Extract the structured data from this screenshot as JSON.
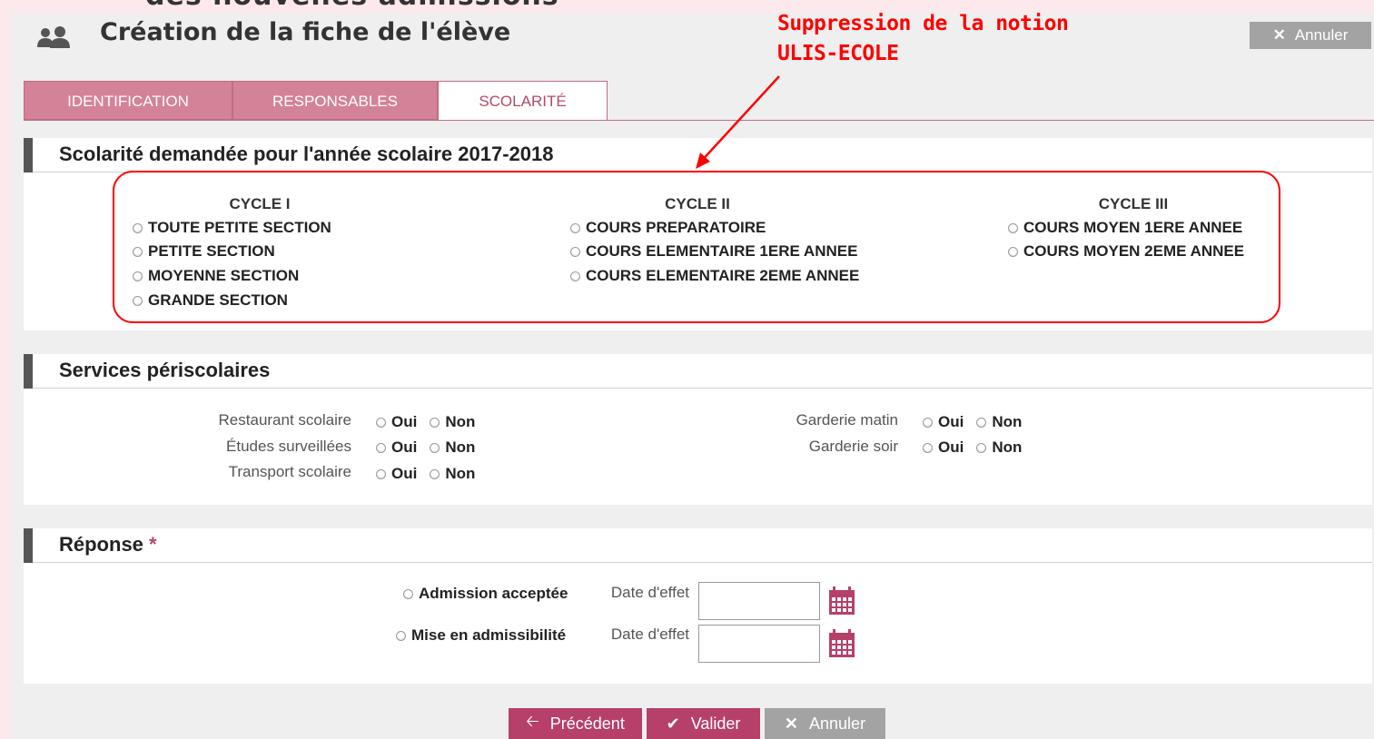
{
  "banner": {
    "partial_title": "des nouvelles admissions"
  },
  "header": {
    "title": "Création de la fiche de l'élève",
    "cancel_label": "Annuler"
  },
  "annotation": {
    "line1": "Suppression de la notion",
    "line2": "ULIS-ECOLE"
  },
  "tabs": [
    {
      "label": "IDENTIFICATION",
      "active": false
    },
    {
      "label": "RESPONSABLES",
      "active": false
    },
    {
      "label": "SCOLARITÉ",
      "active": true
    }
  ],
  "scolarite": {
    "title": "Scolarité demandée pour l'année scolaire 2017-2018",
    "cycles": [
      {
        "heading": "CYCLE I",
        "options": [
          "TOUTE PETITE SECTION",
          "PETITE SECTION",
          "MOYENNE SECTION",
          "GRANDE SECTION"
        ]
      },
      {
        "heading": "CYCLE II",
        "options": [
          "COURS PREPARATOIRE",
          "COURS ELEMENTAIRE 1ERE ANNEE",
          "COURS ELEMENTAIRE 2EME ANNEE"
        ]
      },
      {
        "heading": "CYCLE III",
        "options": [
          "COURS MOYEN 1ERE ANNEE",
          "COURS MOYEN 2EME ANNEE"
        ]
      }
    ]
  },
  "periscolaire": {
    "title": "Services périscolaires",
    "yes_label": "Oui",
    "no_label": "Non",
    "left": [
      "Restaurant scolaire",
      "Études surveillées",
      "Transport scolaire"
    ],
    "right": [
      "Garderie matin",
      "Garderie soir"
    ]
  },
  "reponse": {
    "title": "Réponse",
    "required_mark": "*",
    "options": [
      "Admission acceptée",
      "Mise en admissibilité"
    ],
    "date_label": "Date d'effet"
  },
  "footer": {
    "prev_label": "Précédent",
    "validate_label": "Valider",
    "cancel_label": "Annuler"
  },
  "colors": {
    "accent": "#b6406a",
    "tab_bg": "#d48298",
    "annotation": "#ff0000",
    "cancel_grey": "#a3a3a3"
  }
}
